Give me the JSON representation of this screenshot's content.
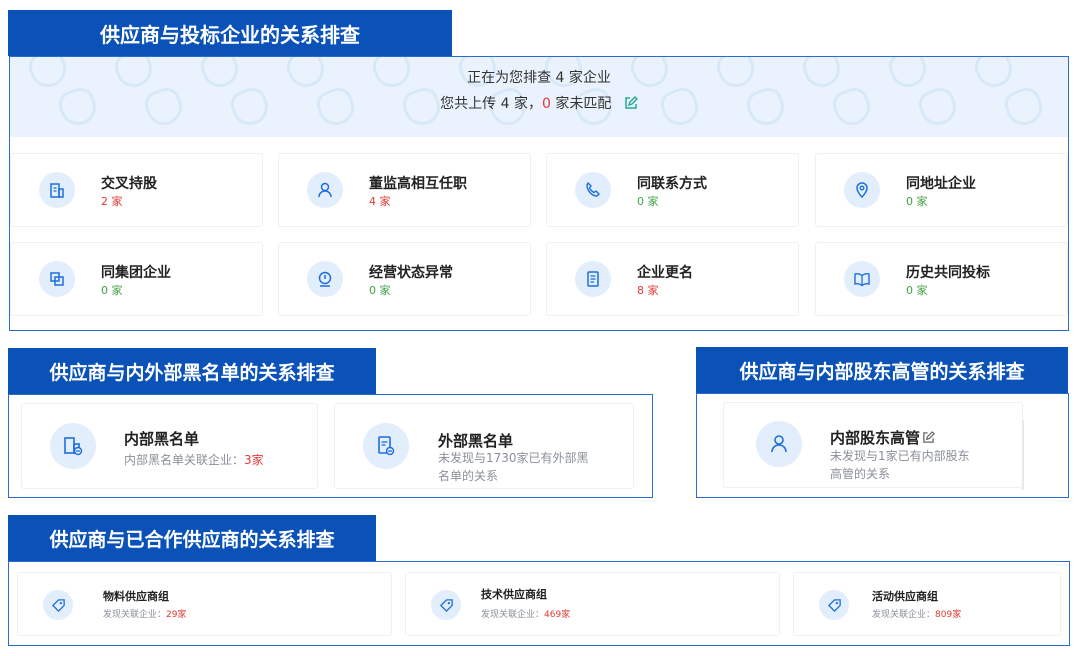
{
  "section1": {
    "title": "供应商与投标企业的关系排查",
    "summary": {
      "line1": "正在为您排查 4 家企业",
      "line2_prefix": "您共上传 4 家，",
      "line2_unmatched": "0",
      "line2_suffix": " 家未匹配"
    },
    "cards": [
      {
        "name": "交叉持股",
        "count": "2 家",
        "status": "red",
        "icon": "building-icon"
      },
      {
        "name": "董监高相互任职",
        "count": "4 家",
        "status": "red",
        "icon": "person-icon"
      },
      {
        "name": "同联系方式",
        "count": "0 家",
        "status": "green",
        "icon": "phone-icon"
      },
      {
        "name": "同地址企业",
        "count": "0 家",
        "status": "green",
        "icon": "location-icon"
      },
      {
        "name": "同集团企业",
        "count": "0 家",
        "status": "green",
        "icon": "group-icon"
      },
      {
        "name": "经营状态异常",
        "count": "0 家",
        "status": "green",
        "icon": "alert-icon"
      },
      {
        "name": "企业更名",
        "count": "8 家",
        "status": "red",
        "icon": "document-icon"
      },
      {
        "name": "历史共同投标",
        "count": "0 家",
        "status": "green",
        "icon": "book-icon"
      }
    ]
  },
  "section2": {
    "title": "供应商与内外部黑名单的关系排查",
    "internal": {
      "name": "内部黑名单",
      "desc_prefix": "内部黑名单关联企业：",
      "count": "3家"
    },
    "external": {
      "name": "外部黑名单",
      "desc_line1": "未发现与1730家已有外部黑",
      "desc_line2": "名单的关系"
    }
  },
  "section3": {
    "title": "供应商与内部股东高管的关系排查",
    "card": {
      "name": "内部股东高管",
      "desc_line1": "未发现与1家已有内部股东",
      "desc_line2": "高管的关系"
    }
  },
  "section4": {
    "title": "供应商与已合作供应商的关系排查",
    "groups": [
      {
        "name": "物料供应商组",
        "desc": "发现关联企业：",
        "count": "29家"
      },
      {
        "name": "技术供应商组",
        "desc": "发现关联企业：",
        "count": "469家"
      },
      {
        "name": "活动供应商组",
        "desc": "发现关联企业：",
        "count": "809家"
      }
    ]
  },
  "colors": {
    "brand": "#0a52b8",
    "red": "#e53935",
    "green": "#43a047",
    "icon_bg": "#e3eefc",
    "icon_stroke": "#1e6fd9"
  }
}
